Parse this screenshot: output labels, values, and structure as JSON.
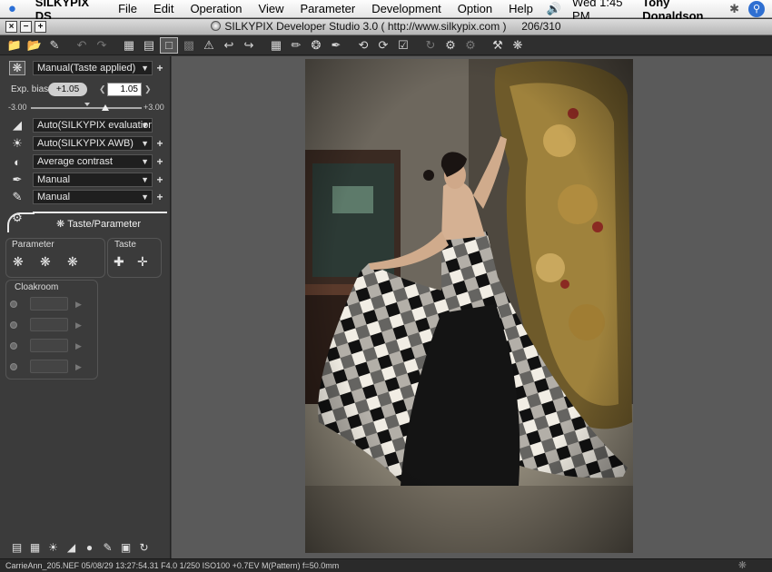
{
  "menubar": {
    "app": "SILKYPIX DS",
    "items": [
      "File",
      "Edit",
      "Operation",
      "View",
      "Parameter",
      "Development",
      "Option",
      "Help"
    ],
    "clock": "Wed 1:45 PM",
    "user": "Tony Donaldson"
  },
  "window": {
    "title": "SILKYPIX Developer Studio 3.0 ( http://www.silkypix.com )",
    "counter": "206/310"
  },
  "panel": {
    "taste": "Manual(Taste applied)",
    "exp_bias_label": "Exp. bias",
    "exp_bias_pill": "+1.05",
    "exp_bias_value": "1.05",
    "slider_min": "-3.00",
    "slider_max": "+3.00",
    "slider_value": 1.05,
    "wb_eval": "Auto(SILKYPIX evaluation)",
    "awb": "Auto(SILKYPIX AWB)",
    "contrast": "Average contrast",
    "sharpness": "Manual",
    "noise": "Manual",
    "tab_label": "Taste/Parameter",
    "parameter_title": "Parameter",
    "taste_title": "Taste",
    "cloakroom_title": "Cloakroom"
  },
  "status": {
    "text": "CarrieAnn_205.NEF 05/08/29 13:27:54.31 F4.0 1/250 ISO100 +0.7EV M(Pattern) f=50.0mm"
  },
  "colors": {
    "panel_bg": "#3b3b3b",
    "preview_bg": "#5a5a5a",
    "accent": "#2f6fd1"
  }
}
